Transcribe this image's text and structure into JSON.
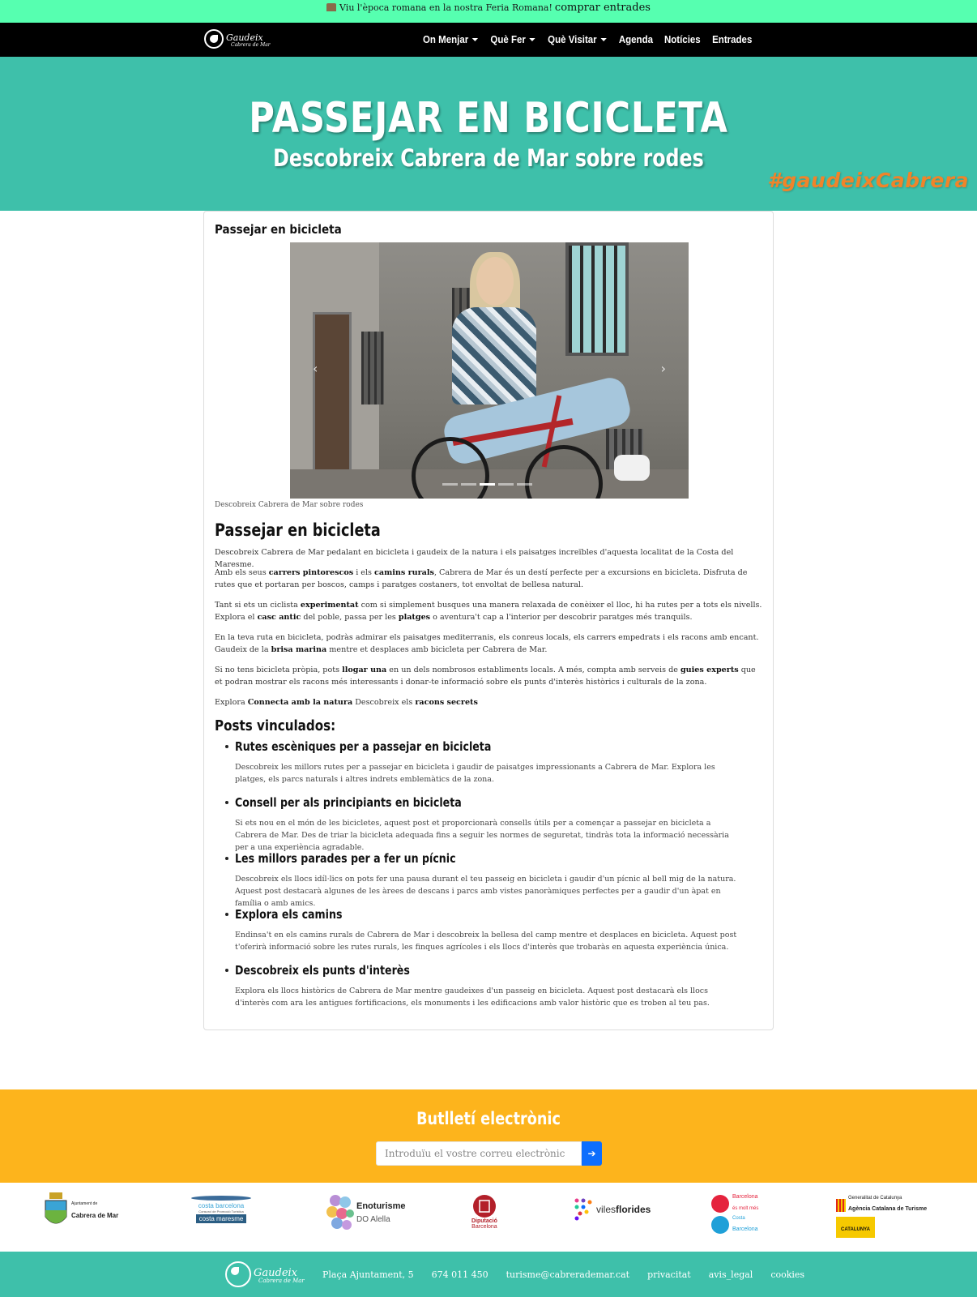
{
  "announcement": {
    "icon": "hut-icon",
    "text": "Viu l'època romana en la nostra Feria Romana!",
    "link": "comprar entrades"
  },
  "nav": {
    "logo_line1": "Gaudeix",
    "logo_line2": "Cabrera de Mar",
    "items": [
      {
        "label": "On Menjar",
        "dropdown": true
      },
      {
        "label": "Què Fer",
        "dropdown": true
      },
      {
        "label": "Què Visitar",
        "dropdown": true
      },
      {
        "label": "Agenda",
        "dropdown": false
      },
      {
        "label": "Notícies",
        "dropdown": false
      },
      {
        "label": "Entrades",
        "dropdown": false
      }
    ]
  },
  "hero": {
    "title": "PASSEJAR EN BICICLETA",
    "subtitle": "Descobreix Cabrera de Mar sobre rodes",
    "hashtag": "#gaudeixCabrera"
  },
  "article": {
    "card_title": "Passejar en bicicleta",
    "carousel": {
      "slides": 5,
      "active_index": 3,
      "prev": "‹",
      "next": "›"
    },
    "caption": "Descobreix Cabrera de Mar sobre rodes",
    "heading": "Passejar en bicicleta",
    "intro": "Descobreix Cabrera de Mar pedalant en bicicleta i gaudeix de la natura i els paisatges increïbles d'aquesta localitat de la Costa del Maresme.",
    "p2": {
      "a": "Amb els seus ",
      "b1": "carrers pintorescos",
      "c": " i els ",
      "b2": "camins rurals",
      "d": ", Cabrera de Mar és un destí perfecte per a excursions en bicicleta. Disfruta de rutes que et portaran per boscos, camps i paratges costaners, tot envoltat de bellesa natural."
    },
    "p3": {
      "a": "Tant si ets un ciclista ",
      "b1": "experimentat",
      "c": " com si simplement busques una manera relaxada de conèixer el lloc, hi ha rutes per a tots els nivells. Explora el ",
      "b2": "casc antic",
      "d": " del poble, passa per les ",
      "b3": "platges",
      "e": " o aventura't cap a l'interior per descobrir paratges més tranquils."
    },
    "p4": {
      "a": "En la teva ruta en bicicleta, podràs admirar els paisatges mediterranis, els conreus locals, els carrers empedrats i els racons amb encant. Gaudeix de la ",
      "b1": "brisa marina",
      "c": " mentre et desplaces amb bicicleta per Cabrera de Mar."
    },
    "p5": {
      "a": "Si no tens bicicleta pròpia, pots ",
      "b1": "llogar una",
      "c": " en un dels nombrosos establiments locals. A més, compta amb serveis de ",
      "b2": "guies experts",
      "d": " que et podran mostrar els racons més interessants i donar-te informació sobre els punts d'interès històrics i culturals de la zona."
    },
    "p6": {
      "a": "Explora ",
      "b1": "Connecta amb la natura",
      "c": " Descobreix els ",
      "b2": "racons secrets"
    },
    "posts_heading": "Posts vinculados:",
    "posts": [
      {
        "title": "Rutes escèniques per a passejar en bicicleta",
        "desc": "Descobreix les millors rutes per a passejar en bicicleta i gaudir de paisatges impressionants a Cabrera de Mar. Explora les platges, els parcs naturals i altres indrets emblemàtics de la zona."
      },
      {
        "title": "Consell per als principiants en bicicleta",
        "desc": "Si ets nou en el món de les bicicletes, aquest post et proporcionarà consells útils per a començar a passejar en bicicleta a Cabrera de Mar. Des de triar la bicicleta adequada fins a seguir les normes de seguretat, tindràs tota la informació necessària per a una experiència agradable."
      },
      {
        "title": "Les millors parades per a fer un pícnic",
        "desc": "Descobreix els llocs idíl·lics on pots fer una pausa durant el teu passeig en bicicleta i gaudir d'un pícnic al bell mig de la natura. Aquest post destacarà algunes de les àrees de descans i parcs amb vistes panoràmiques perfectes per a gaudir d'un àpat en família o amb amics."
      },
      {
        "title": "Explora els camins",
        "desc": "Endinsa't en els camins rurals de Cabrera de Mar i descobreix la bellesa del camp mentre et desplaces en bicicleta. Aquest post t'oferirà informació sobre les rutes rurals, les finques agrícoles i els llocs d'interès que trobaràs en aquesta experiència única."
      },
      {
        "title": "Descobreix els punts d'interès",
        "desc": "Explora els llocs històrics de Cabrera de Mar mentre gaudeixes d'un passeig en bicicleta. Aquest post destacarà els llocs d'interès com ara les antigues fortificacions, els monuments i les edificacions amb valor històric que es troben al teu pas."
      }
    ]
  },
  "newsletter": {
    "title": "Butlletí electrònic",
    "placeholder": "Introduïu el vostre correu electrònic",
    "submit_icon": "arrow-right-icon",
    "submit_glyph": "➔"
  },
  "sponsors": [
    {
      "name": "ajuntament-cabrera-logo",
      "line1": "Ajuntament de",
      "line2": "Cabrera de Mar"
    },
    {
      "name": "costa-barcelona-maresme-logo",
      "line1": "costa barcelona",
      "line2": "Consorci de Promoció Turística",
      "line3": "costa maresme"
    },
    {
      "name": "enoturisme-alella-logo",
      "line1": "Enoturisme",
      "line2": "DO Alella"
    },
    {
      "name": "diputacio-barcelona-logo",
      "line1": "Diputació",
      "line2": "Barcelona"
    },
    {
      "name": "viles-florides-logo",
      "line1": "viles",
      "line2": "florides"
    },
    {
      "name": "barcelona-es-molt-mes-logo",
      "line1": "Barcelona",
      "line2": "és molt més",
      "line3": "Costa",
      "line4": "Barcelona"
    },
    {
      "name": "generalitat-act-logo",
      "line1": "Generalitat de Catalunya",
      "line2": "Agència Catalana de Turisme",
      "line3": "CATALUNYA"
    }
  ],
  "footer": {
    "address": "Plaça Ajuntament, 5",
    "phone": "674 011 450",
    "email": "turisme@cabrerademar.cat",
    "links": [
      "privacitat",
      "avis_legal",
      "cookies"
    ]
  },
  "colors": {
    "announcement_bg": "#56ffb0",
    "navbar_bg": "#000000",
    "hero_bg": "#3ec0aa",
    "hashtag": "#f0842a",
    "newsletter_bg": "#fdb41c",
    "submit_button": "#0d6efd",
    "footer_bg": "#3ec0aa"
  }
}
